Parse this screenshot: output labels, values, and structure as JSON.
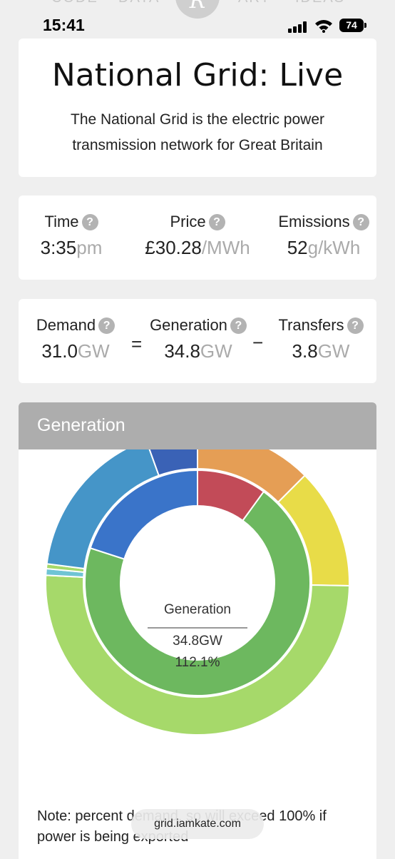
{
  "ghost_nav": [
    "CODE",
    "DATA",
    "ART",
    "IDEAS"
  ],
  "logo_glyph": "R",
  "status_bar": {
    "time": "15:41",
    "battery": "74"
  },
  "header": {
    "title": "National Grid: Live",
    "subtitle": "The National Grid is the electric power transmission network for Great Britain"
  },
  "stats_row1": [
    {
      "label": "Time",
      "value": "3:35",
      "unit": "pm"
    },
    {
      "label": "Price",
      "value": "£30.28",
      "unit": "/MWh"
    },
    {
      "label": "Emissions",
      "value": "52",
      "unit": "g/kWh"
    }
  ],
  "stats_row2": [
    {
      "label": "Demand",
      "value": "31.0",
      "unit": "GW"
    },
    {
      "label": "Generation",
      "value": "34.8",
      "unit": "GW"
    },
    {
      "label": "Transfers",
      "value": "3.8",
      "unit": "GW"
    }
  ],
  "help_glyph": "?",
  "operators": {
    "equals": "=",
    "minus": "−"
  },
  "generation": {
    "header": "Generation",
    "center_title": "Generation",
    "center_total": "34.8GW",
    "center_percent": "112.1%",
    "outer_ring": [
      {
        "share": 0.125,
        "color": "#e59e55"
      },
      {
        "share": 0.128,
        "color": "#e8dc48"
      },
      {
        "share": 0.505,
        "color": "#a6d96a"
      },
      {
        "share": 0.007,
        "color": "#6fc4d4"
      },
      {
        "share": 0.005,
        "color": "#a6d96a"
      },
      {
        "share": 0.175,
        "color": "#4595c8"
      },
      {
        "share": 0.055,
        "color": "#3a62b6"
      }
    ],
    "inner_ring": [
      {
        "share": 0.1,
        "color": "#c24b58"
      },
      {
        "share": 0.7,
        "color": "#6db85f"
      },
      {
        "share": 0.2,
        "color": "#3a74c9"
      }
    ],
    "note": "Note: percent                                      demand, so will exceed 100% if power is being exported"
  },
  "url_bar": {
    "url": "grid.iamkate.com"
  }
}
